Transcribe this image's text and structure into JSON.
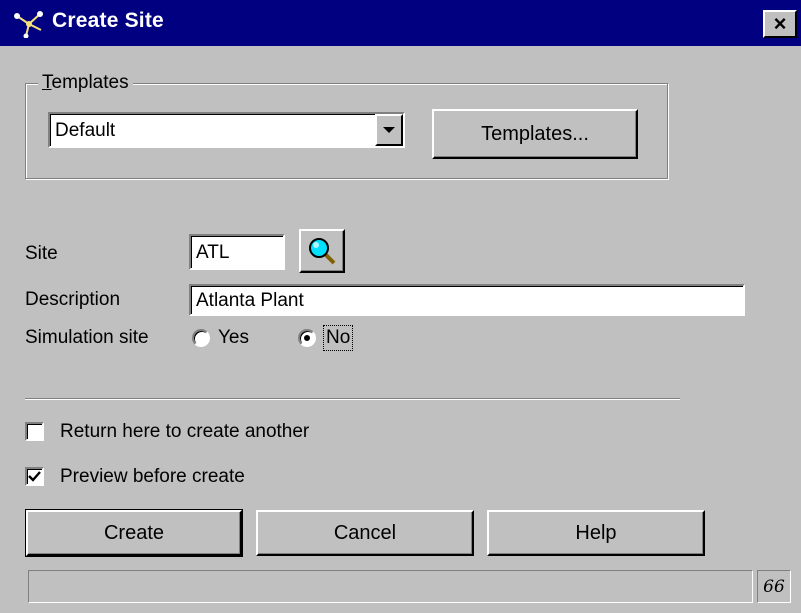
{
  "window": {
    "title": "Create Site",
    "close_label": "×",
    "app_icon": "plant-network-icon"
  },
  "templates_group": {
    "legend_first": "T",
    "legend_rest": "emplates",
    "selected": "Default",
    "button_label": "Templates..."
  },
  "form": {
    "site_label": "Site",
    "site_value": "ATL",
    "lookup_icon": "magnifier-icon",
    "description_label": "Description",
    "description_value": "Atlanta Plant",
    "simulation_label": "Simulation site",
    "simulation_options": [
      "Yes",
      "No"
    ],
    "simulation_selected": "No"
  },
  "options": {
    "return_label": "Return here to create another",
    "return_checked": false,
    "preview_label": "Preview before create",
    "preview_checked": true
  },
  "buttons": {
    "create": "Create",
    "cancel": "Cancel",
    "help": "Help"
  },
  "status": {
    "text": "",
    "indicator": "66"
  },
  "colors": {
    "title_bar": "#000080",
    "face": "#c0c0c0",
    "field": "#ffffff"
  }
}
